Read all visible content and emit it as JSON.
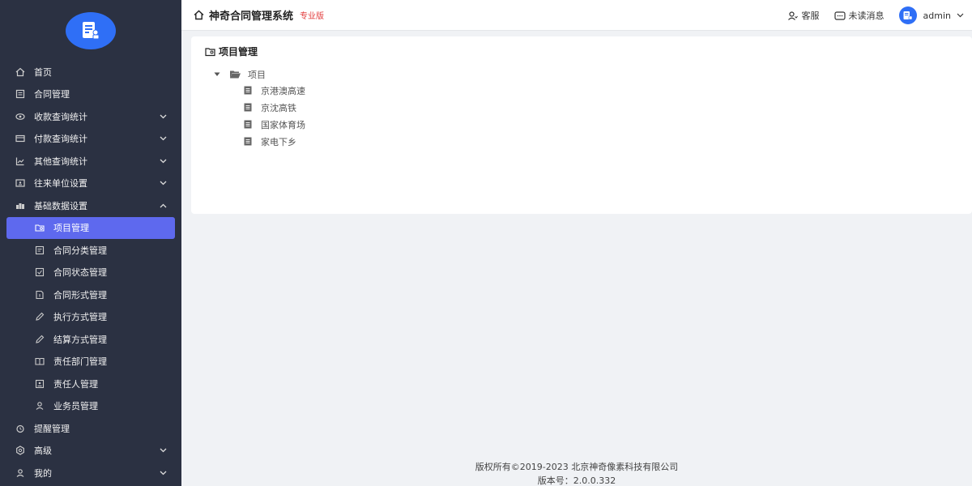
{
  "sidebar": {
    "items": [
      {
        "label": "首页",
        "icon": "home-icon",
        "arrow": ""
      },
      {
        "label": "合同管理",
        "icon": "document-icon",
        "arrow": ""
      },
      {
        "label": "收款查询统计",
        "icon": "eye-icon",
        "arrow": "down"
      },
      {
        "label": "付款查询统计",
        "icon": "card-icon",
        "arrow": "down"
      },
      {
        "label": "其他查询统计",
        "icon": "line-chart-icon",
        "arrow": "down"
      },
      {
        "label": "往来单位设置",
        "icon": "contact-card-icon",
        "arrow": "down"
      },
      {
        "label": "基础数据设置",
        "icon": "database-icon",
        "arrow": "up"
      }
    ],
    "sub_items": [
      {
        "label": "项目管理",
        "icon": "folder-icon",
        "active": true
      },
      {
        "label": "合同分类管理",
        "icon": "document-icon"
      },
      {
        "label": "合同状态管理",
        "icon": "status-icon"
      },
      {
        "label": "合同形式管理",
        "icon": "form-icon"
      },
      {
        "label": "执行方式管理",
        "icon": "pencil-icon"
      },
      {
        "label": "结算方式管理",
        "icon": "pencil-icon"
      },
      {
        "label": "责任部门管理",
        "icon": "book-icon"
      },
      {
        "label": "责任人管理",
        "icon": "id-card-icon"
      },
      {
        "label": "业务员管理",
        "icon": "user-icon"
      }
    ],
    "bottom_items": [
      {
        "label": "提醒管理",
        "icon": "alarm-icon",
        "arrow": ""
      },
      {
        "label": "高级",
        "icon": "gear-icon",
        "arrow": "down"
      },
      {
        "label": "我的",
        "icon": "user-icon",
        "arrow": "down"
      }
    ]
  },
  "header": {
    "title": "神奇合同管理系统",
    "badge": "专业版",
    "service": "客服",
    "messages": "未读消息",
    "user": "admin"
  },
  "main": {
    "title": "项目管理",
    "tree": {
      "root": "项目",
      "children": [
        "京港澳高速",
        "京沈高铁",
        "国家体育场",
        "家电下乡"
      ]
    }
  },
  "footer": {
    "copyright": "版权所有©2019-2023 北京神奇像素科技有限公司",
    "version": "版本号：2.0.0.332"
  },
  "colors": {
    "sidebar_bg": "#2b3142",
    "active_bg": "#5e69ee",
    "brand": "#2f6ff6",
    "badge": "#e23c3c"
  }
}
